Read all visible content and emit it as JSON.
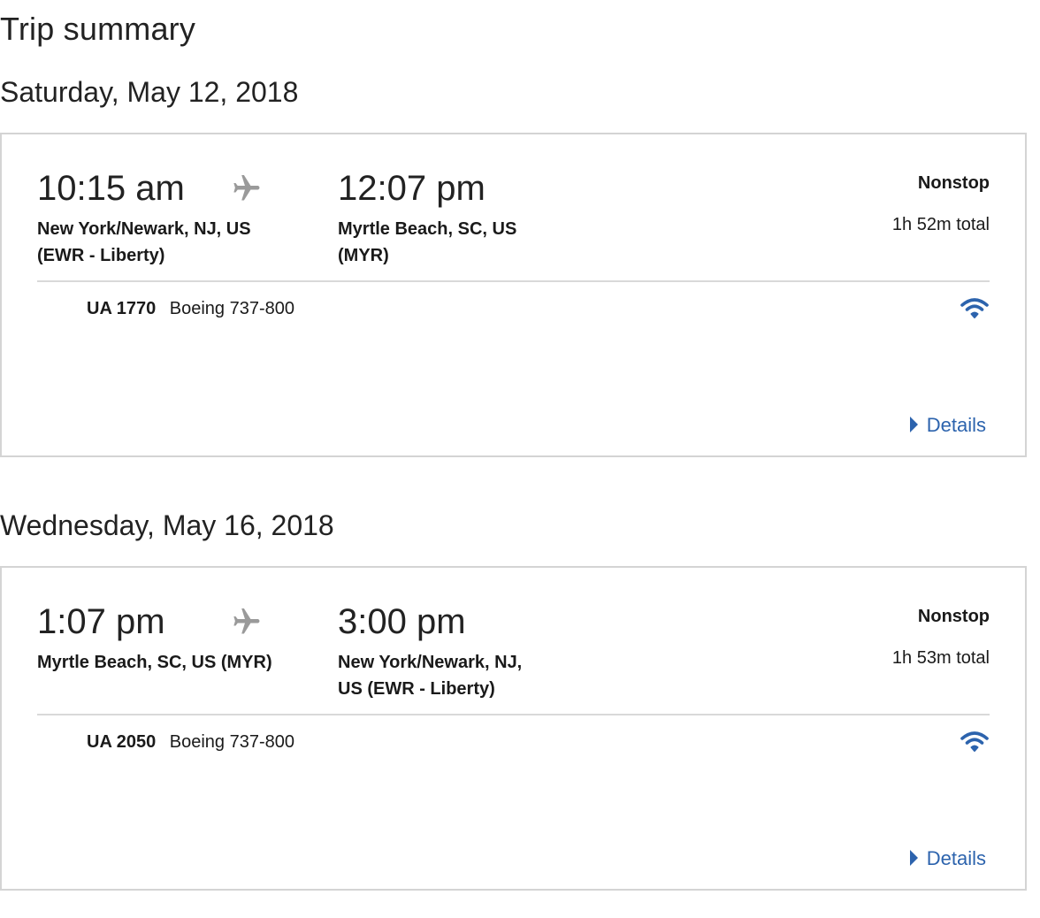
{
  "page_title": "Trip summary",
  "colors": {
    "link": "#2c63ad",
    "wifi": "#2c63ad",
    "plane": "#9a9a9a",
    "border": "#d4d4d4"
  },
  "flights": [
    {
      "date": "Saturday, May 12, 2018",
      "depart_time": "10:15 am",
      "depart_airport_line1": "New York/Newark, NJ, US",
      "depart_airport_line2": "(EWR - Liberty)",
      "arrive_time": "12:07 pm",
      "arrive_airport_line1": "Myrtle Beach, SC, US",
      "arrive_airport_line2": "(MYR)",
      "stops": "Nonstop",
      "duration": "1h 52m total",
      "flight_number": "UA 1770",
      "aircraft": "Boeing 737-800",
      "amenity_icon": "wifi-icon",
      "details_label": "Details"
    },
    {
      "date": "Wednesday, May 16, 2018",
      "depart_time": "1:07 pm",
      "depart_airport_line1": "Myrtle Beach, SC, US (MYR)",
      "depart_airport_line2": "",
      "arrive_time": "3:00 pm",
      "arrive_airport_line1": "New York/Newark, NJ,",
      "arrive_airport_line2": "US (EWR - Liberty)",
      "stops": "Nonstop",
      "duration": "1h 53m total",
      "flight_number": "UA 2050",
      "aircraft": "Boeing 737-800",
      "amenity_icon": "wifi-icon",
      "details_label": "Details"
    }
  ]
}
